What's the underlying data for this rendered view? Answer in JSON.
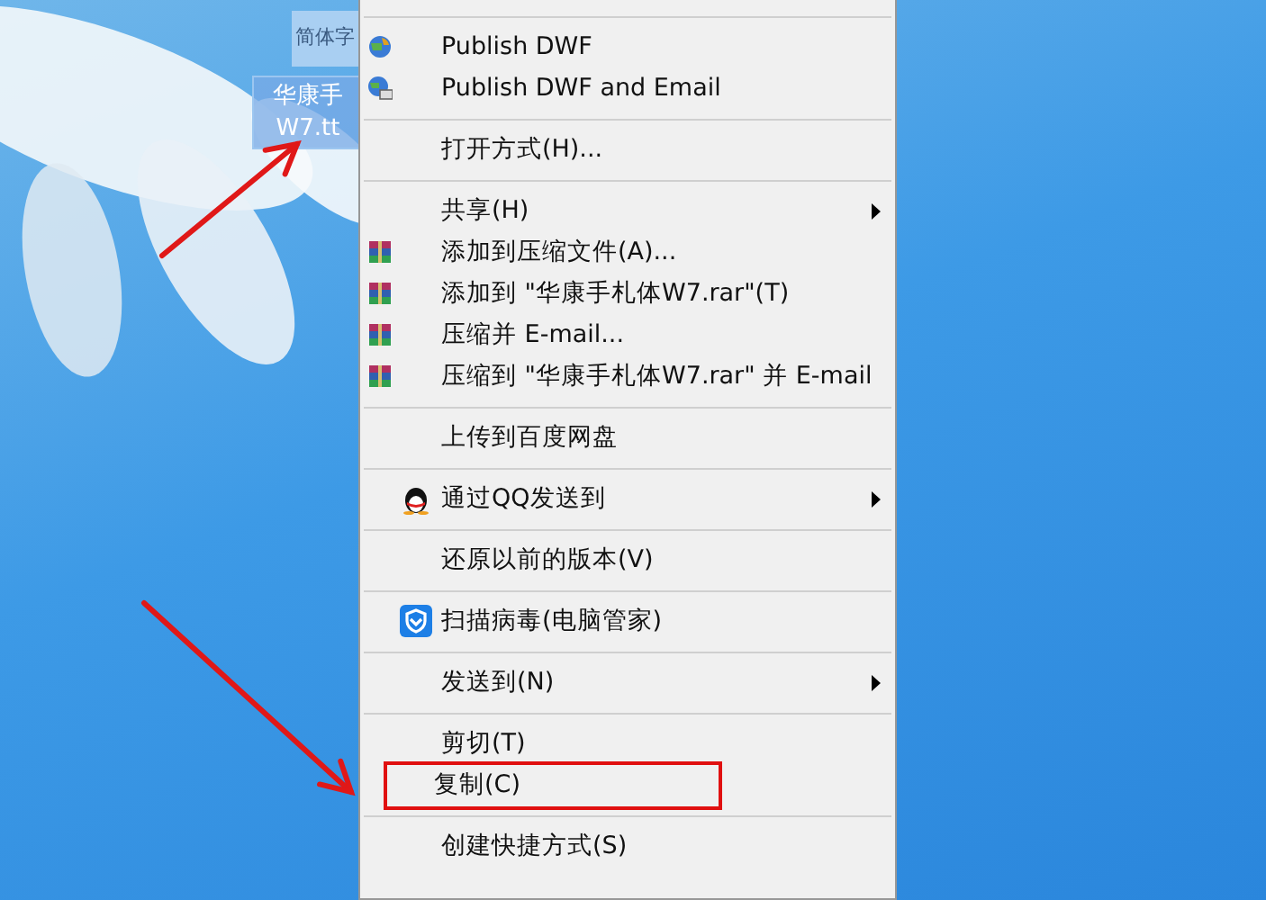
{
  "desktop_icons": [
    {
      "label_lines": [
        "简体字"
      ],
      "selected": false
    },
    {
      "label_lines": [
        "华康手",
        "W7.tt"
      ],
      "selected": true
    }
  ],
  "context_menu": {
    "items": [
      {
        "kind": "separator"
      },
      {
        "kind": "dwf",
        "label": "Publish DWF",
        "submenu": false,
        "boxed": false
      },
      {
        "kind": "dwf-email",
        "label": "Publish DWF and Email",
        "submenu": false,
        "boxed": false
      },
      {
        "kind": "separator"
      },
      {
        "kind": "plain",
        "label": "打开方式(H)...",
        "submenu": false,
        "boxed": false
      },
      {
        "kind": "separator"
      },
      {
        "kind": "plain",
        "label": "共享(H)",
        "submenu": true,
        "boxed": false
      },
      {
        "kind": "archive",
        "label": "添加到压缩文件(A)...",
        "submenu": false,
        "boxed": false
      },
      {
        "kind": "archive",
        "label": "添加到 \"华康手札体W7.rar\"(T)",
        "submenu": false,
        "boxed": false
      },
      {
        "kind": "archive",
        "label": "压缩并 E-mail...",
        "submenu": false,
        "boxed": false
      },
      {
        "kind": "archive",
        "label": "压缩到 \"华康手札体W7.rar\" 并 E-mail",
        "submenu": false,
        "boxed": false
      },
      {
        "kind": "separator"
      },
      {
        "kind": "plain",
        "label": "上传到百度网盘",
        "submenu": false,
        "boxed": false
      },
      {
        "kind": "separator"
      },
      {
        "kind": "qq",
        "label": "通过QQ发送到",
        "submenu": true,
        "boxed": false
      },
      {
        "kind": "separator"
      },
      {
        "kind": "plain",
        "label": "还原以前的版本(V)",
        "submenu": false,
        "boxed": false
      },
      {
        "kind": "separator"
      },
      {
        "kind": "antivirus",
        "label": "扫描病毒(电脑管家)",
        "submenu": false,
        "boxed": false
      },
      {
        "kind": "separator"
      },
      {
        "kind": "plain",
        "label": "发送到(N)",
        "submenu": true,
        "boxed": false
      },
      {
        "kind": "separator"
      },
      {
        "kind": "plain",
        "label": "剪切(T)",
        "submenu": false,
        "boxed": false
      },
      {
        "kind": "plain",
        "label": "复制(C)",
        "submenu": false,
        "boxed": true
      },
      {
        "kind": "separator"
      },
      {
        "kind": "plain",
        "label": "创建快捷方式(S)",
        "submenu": false,
        "boxed": false
      }
    ]
  }
}
